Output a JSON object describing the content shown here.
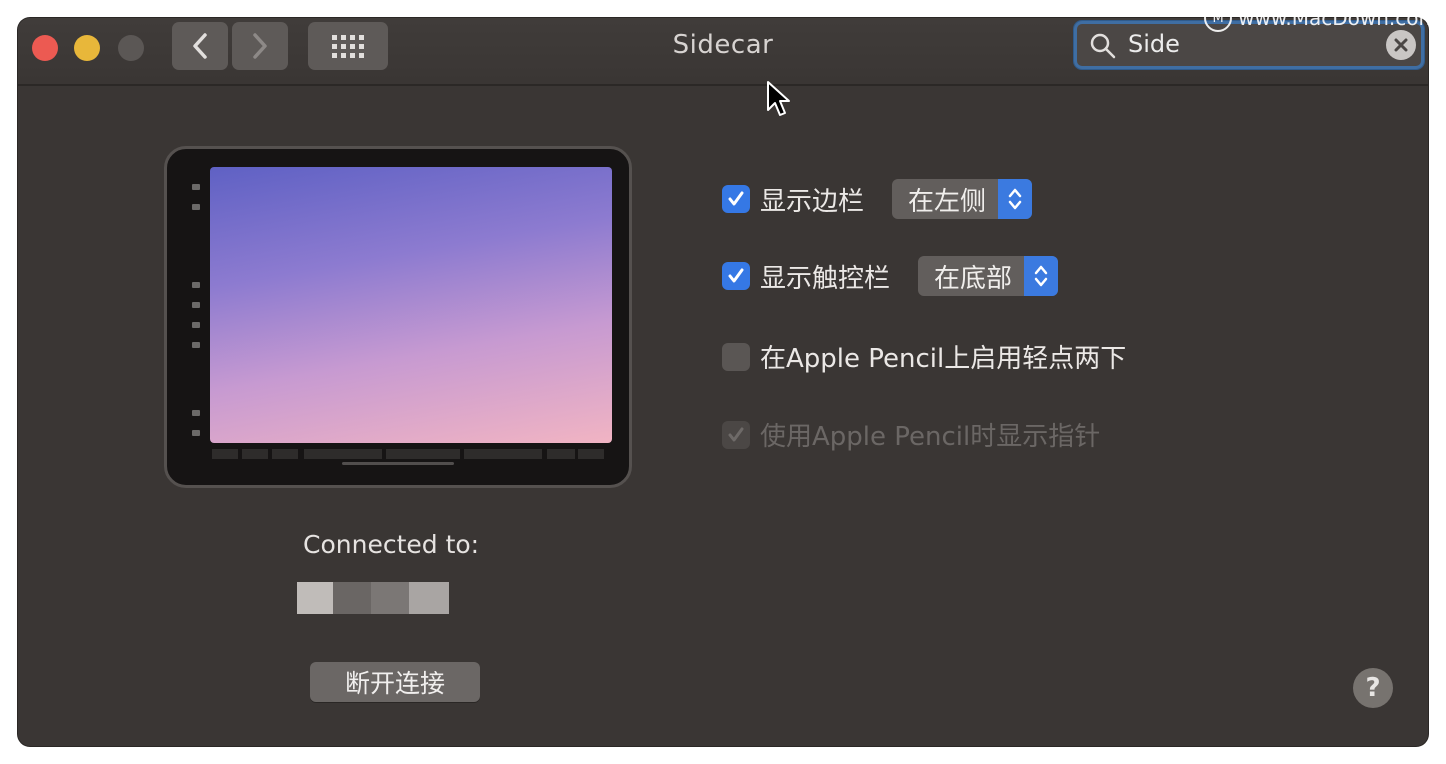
{
  "window": {
    "title": "Sidecar",
    "search": {
      "value": "Side",
      "icon": "magnifier"
    }
  },
  "watermark": {
    "text": "www.MacDown.com",
    "logo": "M"
  },
  "device": {
    "connected_label": "Connected to:",
    "disconnect_label": "断开连接"
  },
  "options": [
    {
      "label": "显示边栏",
      "checked": true,
      "enabled": true,
      "select": "在左侧"
    },
    {
      "label": "显示触控栏",
      "checked": true,
      "enabled": true,
      "select": "在底部"
    },
    {
      "label": "在Apple Pencil上启用轻点两下",
      "checked": false,
      "enabled": true
    },
    {
      "label": "使用Apple Pencil时显示指针",
      "checked": true,
      "enabled": false
    }
  ],
  "help": {
    "label": "?"
  },
  "colors": {
    "accent": "#3578e5",
    "window_bg": "#3a3634",
    "close": "#ec5a52",
    "minimize": "#e8b73a"
  }
}
